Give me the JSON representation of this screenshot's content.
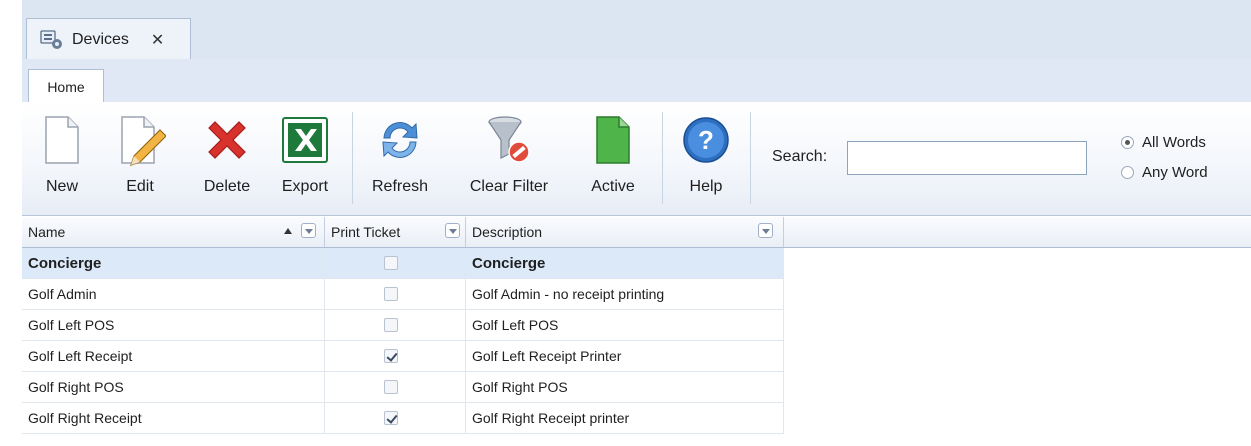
{
  "document_tab": {
    "title": "Devices",
    "close_glyph": "✕",
    "icon": "devices-icon"
  },
  "ribbon_tabs": [
    {
      "label": "Home"
    }
  ],
  "toolbar": {
    "buttons": [
      {
        "id": "new",
        "label": "New",
        "icon": "new-document-icon"
      },
      {
        "id": "edit",
        "label": "Edit",
        "icon": "edit-pencil-icon"
      },
      {
        "id": "delete",
        "label": "Delete",
        "icon": "red-x-icon"
      },
      {
        "id": "export",
        "label": "Export",
        "icon": "excel-icon"
      },
      {
        "id": "refresh",
        "label": "Refresh",
        "icon": "refresh-arrows-icon"
      },
      {
        "id": "clear_filter",
        "label": "Clear Filter",
        "icon": "funnel-clear-icon"
      },
      {
        "id": "active",
        "label": "Active",
        "icon": "green-document-icon"
      },
      {
        "id": "help",
        "label": "Help",
        "icon": "help-icon"
      }
    ]
  },
  "search": {
    "label": "Search:",
    "value": "",
    "options": [
      {
        "label": "All Words",
        "selected": true
      },
      {
        "label": "Any Word",
        "selected": false
      }
    ]
  },
  "grid": {
    "columns": [
      {
        "label": "Name",
        "sort": "ascending"
      },
      {
        "label": "Print Ticket"
      },
      {
        "label": "Description"
      }
    ],
    "rows": [
      {
        "name": "Concierge",
        "print_ticket": false,
        "description": "Concierge",
        "selected": true
      },
      {
        "name": "Golf Admin",
        "print_ticket": false,
        "description": "Golf Admin - no receipt printing"
      },
      {
        "name": "Golf Left POS",
        "print_ticket": false,
        "description": "Golf Left POS"
      },
      {
        "name": "Golf Left Receipt",
        "print_ticket": true,
        "description": "Golf Left Receipt Printer"
      },
      {
        "name": "Golf Right POS",
        "print_ticket": false,
        "description": "Golf Right POS"
      },
      {
        "name": "Golf Right Receipt",
        "print_ticket": true,
        "description": "Golf Right Receipt printer"
      }
    ]
  },
  "colors": {
    "accent": "#dbe9f8",
    "chrome": "#dce6f2",
    "delete": "#d9312b",
    "excel": "#1d7a3a"
  }
}
